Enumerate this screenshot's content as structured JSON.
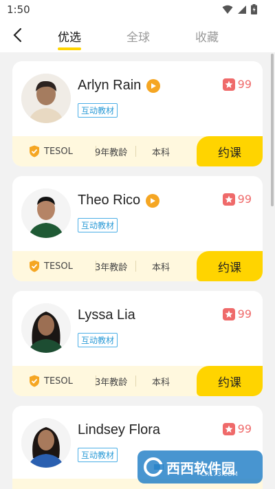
{
  "status": {
    "time": "1:50"
  },
  "nav": {
    "tabs": [
      {
        "label": "优选",
        "active": true
      },
      {
        "label": "全球",
        "active": false
      },
      {
        "label": "收藏",
        "active": false
      }
    ]
  },
  "teachers": [
    {
      "name": "Arlyn Rain",
      "tag": "互动教材",
      "rating": "99",
      "cert": "TESOL",
      "years": "9年教龄",
      "degree": "本科",
      "action": "约课"
    },
    {
      "name": "Theo Rico",
      "tag": "互动教材",
      "rating": "99",
      "cert": "TESOL",
      "years": "3年教龄",
      "degree": "本科",
      "action": "约课"
    },
    {
      "name": "Lyssa Lia",
      "tag": "互动教材",
      "rating": "99",
      "cert": "TESOL",
      "years": "3年教龄",
      "degree": "本科",
      "action": "约课"
    },
    {
      "name": "Lindsey Flora",
      "tag": "互动教材",
      "rating": "99"
    }
  ],
  "watermark": {
    "text": "西西软件园",
    "sub": "CR173.COM"
  },
  "colors": {
    "accent": "#ffd400",
    "rating": "#ef6a6a",
    "tag": "#2a9ad6",
    "play": "#f5a623"
  }
}
